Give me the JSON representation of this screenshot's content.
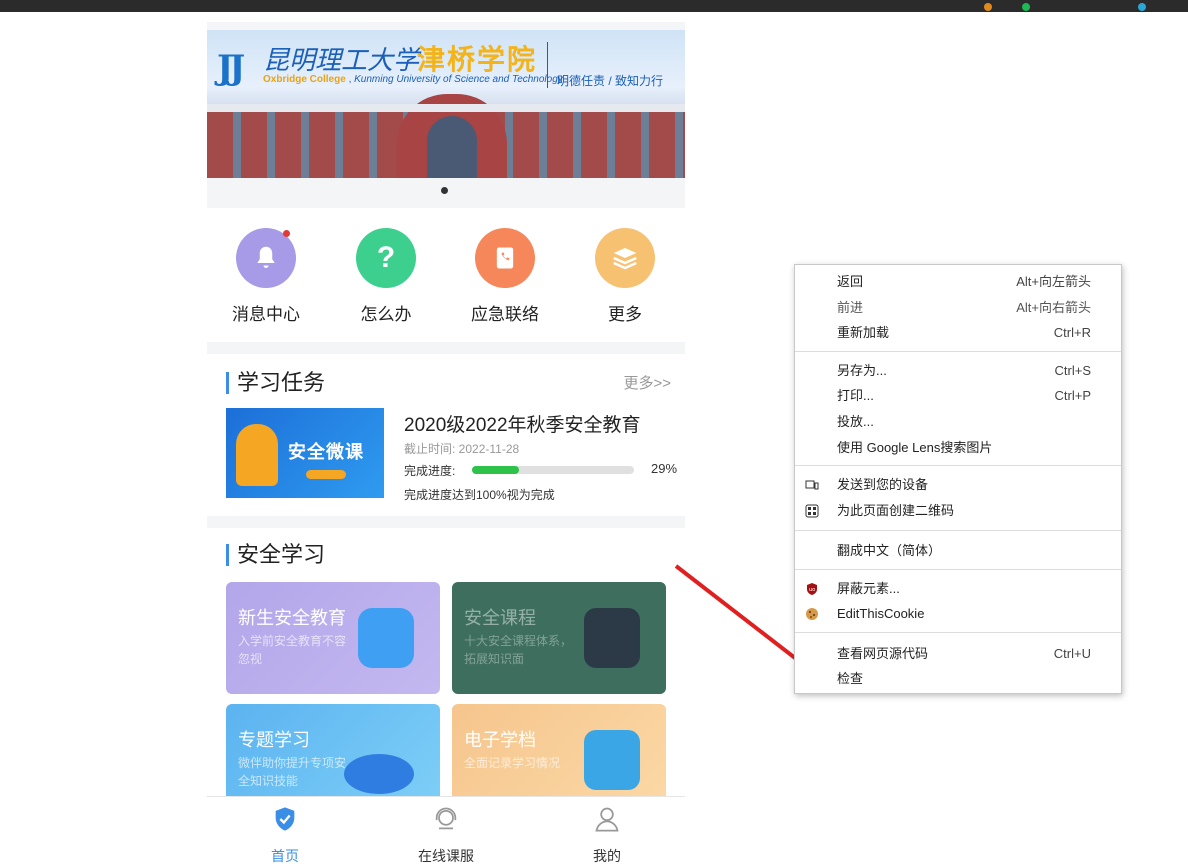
{
  "banner": {
    "logo_cn": "昆明理工大学",
    "college_cn": "津桥学院",
    "en_college": "Oxbridge College",
    "en_university": "Kunming University of Science and Technology",
    "motto": "明德任责 / 致知力行"
  },
  "quick_icons": [
    {
      "label": "消息中心",
      "color": "#a79ae6",
      "icon": "bell-icon",
      "badge": true
    },
    {
      "label": "怎么办",
      "color": "#3ccf8e",
      "icon": "question-icon"
    },
    {
      "label": "应急联络",
      "color": "#f5875a",
      "icon": "phone-book-icon"
    },
    {
      "label": "更多",
      "color": "#f7c172",
      "icon": "layers-icon"
    }
  ],
  "tasks": {
    "title": "学习任务",
    "more": "更多>>",
    "item": {
      "thumb_text": "安全微课",
      "title": "2020级2022年秋季安全教育",
      "deadline": "截止时间: 2022-11-28",
      "progress_label": "完成进度:",
      "progress": 0.29,
      "progress_text": "29%",
      "note": "完成进度达到100%视为完成"
    }
  },
  "safety": {
    "title": "安全学习",
    "tiles": [
      {
        "title": "新生安全教育",
        "subtitle": "入学前安全教育不容忽视",
        "color": "#b3a6ea"
      },
      {
        "title": "安全课程",
        "subtitle": "十大安全课程体系，拓展知识面",
        "color": "#3e6f5e"
      },
      {
        "title": "专题学习",
        "subtitle": "微伴助你提升专项安全知识技能",
        "color": "#62b9f2"
      },
      {
        "title": "电子学档",
        "subtitle": "全面记录学习情况",
        "color": "#f6c58d"
      }
    ]
  },
  "tabbar": [
    {
      "label": "首页",
      "active": true,
      "icon": "shield-check-icon"
    },
    {
      "label": "在线课服",
      "active": false,
      "icon": "headset-icon"
    },
    {
      "label": "我的",
      "active": false,
      "icon": "user-icon"
    }
  ],
  "context_menu": {
    "back": "返回",
    "back_sc": "Alt+向左箭头",
    "forward": "前进",
    "forward_sc": "Alt+向右箭头",
    "reload": "重新加载",
    "reload_sc": "Ctrl+R",
    "save_as": "另存为...",
    "save_as_sc": "Ctrl+S",
    "print": "打印...",
    "print_sc": "Ctrl+P",
    "cast": "投放...",
    "lens": "使用 Google Lens搜索图片",
    "send_device": "发送到您的设备",
    "qr": "为此页面创建二维码",
    "translate": "翻成中文（简体）",
    "block": "屏蔽元素...",
    "cookie": "EditThisCookie",
    "view_source": "查看网页源代码",
    "view_source_sc": "Ctrl+U",
    "inspect": "检查"
  },
  "colors": {
    "accent_blue": "#3a8ee6",
    "arrow_red": "#e02020",
    "progress_green": "#2ec24a"
  }
}
